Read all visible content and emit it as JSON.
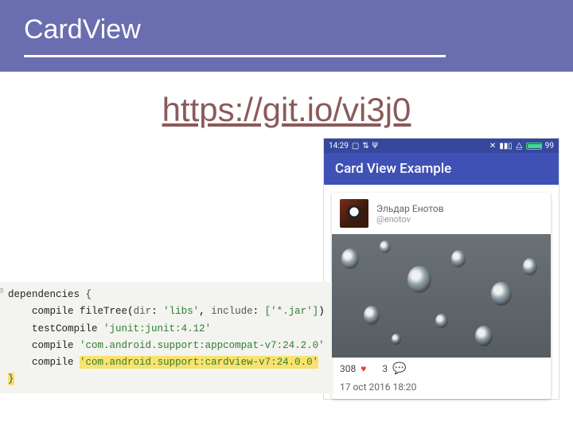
{
  "slide": {
    "title": "CardView",
    "link": "https://git.io/vi3j0"
  },
  "code": {
    "header": "dependencies",
    "l1a": "compile",
    "l1b": "fileTree",
    "l1c": "dir",
    "l1d": "'libs'",
    "l1e": "include",
    "l1f": "['*.jar']",
    "l2a": "testCompile",
    "l2b": "'junit:junit:4.12'",
    "l3a": "compile",
    "l3b": "'com.android.support:appcompat-v7:24.2.0'",
    "l4a": "compile",
    "l4b": "'com.android.support:cardview-v7:24.0.0'"
  },
  "phone": {
    "status": {
      "time": "14:29",
      "battery": "99"
    },
    "appbar": "Card View Example",
    "card": {
      "user_name": "Эльдар Енотов",
      "user_handle": "@enotov",
      "likes": "308",
      "comments": "3",
      "timestamp": "17 oct 2016 18:20"
    }
  }
}
